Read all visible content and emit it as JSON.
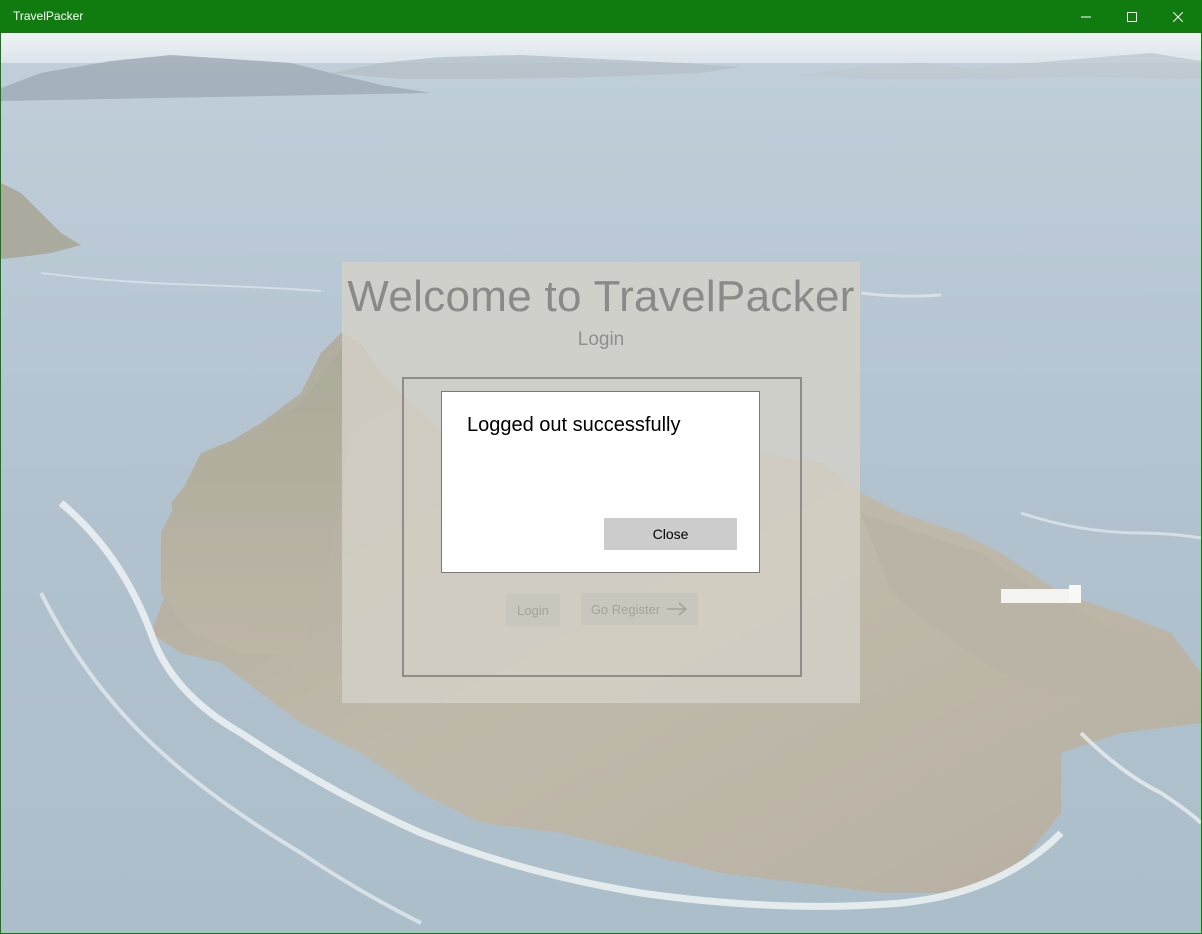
{
  "window": {
    "title": "TravelPacker",
    "controls": {
      "minimize": "minimize-icon",
      "maximize": "maximize-icon",
      "close": "close-icon"
    }
  },
  "login_panel": {
    "heading": "Welcome to TravelPacker",
    "subtitle": "Login",
    "login_button": "Login",
    "register_button": "Go Register",
    "register_icon": "arrow-right-icon"
  },
  "dialog": {
    "message": "Logged out successfully",
    "close_button": "Close"
  },
  "colors": {
    "titlebar": "#107c10",
    "dialog_button": "#cccccc"
  }
}
